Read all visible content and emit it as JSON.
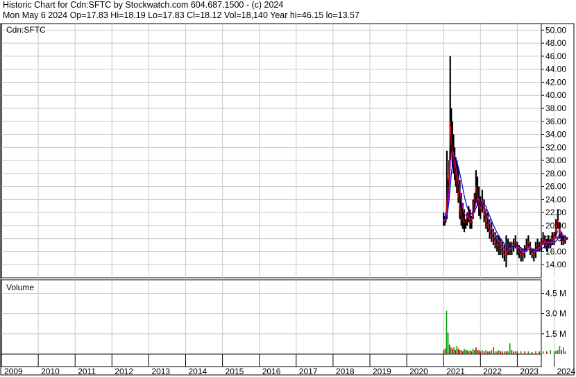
{
  "header": {
    "line1": "Historic Chart for Cdn:SFTC by Stockwatch.com 604.687.1500 - (c) 2024",
    "line2": "Mon May  6 2024   Op=17.83   Hi=18.19   Lo=17.83   Cl=18.12   Vol=18,140   Year hi=46.15   lo=13.57"
  },
  "chart_data": {
    "type": "line",
    "symbol_label": "Cdn:SFTC",
    "volume_label": "Volume",
    "price_axis": {
      "ylim": [
        12,
        51
      ],
      "ticks": [
        "14.00",
        "16.00",
        "18.00",
        "20.00",
        "22.00",
        "24.00",
        "26.00",
        "28.00",
        "30.00",
        "32.00",
        "34.00",
        "36.00",
        "38.00",
        "40.00",
        "42.00",
        "44.00",
        "46.00",
        "48.00",
        "50.00"
      ]
    },
    "volume_axis": {
      "ylim": [
        0,
        5.5
      ],
      "ticks": [
        "1.5 M",
        "3.0 M",
        "4.5 M"
      ]
    },
    "x_axis": {
      "years": [
        "2009",
        "2010",
        "2011",
        "2012",
        "2013",
        "2014",
        "2015",
        "2016",
        "2017",
        "2018",
        "2019",
        "2020",
        "2021",
        "2022",
        "2023",
        "2024"
      ]
    },
    "grid": true,
    "colors": {
      "price": "#000000",
      "ma_short": "#cc0000",
      "ma_long": "#0000cc",
      "ma_mid": "#cc00cc",
      "volume_up": "#00a000",
      "volume_down": "#cc0000",
      "grid": "#c8c8c8"
    },
    "price_series": {
      "x": [
        2021.0,
        2021.03,
        2021.06,
        2021.09,
        2021.12,
        2021.15,
        2021.18,
        2021.21,
        2021.24,
        2021.27,
        2021.3,
        2021.33,
        2021.36,
        2021.4,
        2021.44,
        2021.48,
        2021.52,
        2021.56,
        2021.6,
        2021.64,
        2021.68,
        2021.72,
        2021.76,
        2021.8,
        2021.84,
        2021.88,
        2021.92,
        2021.96,
        2022.0,
        2022.05,
        2022.1,
        2022.15,
        2022.2,
        2022.25,
        2022.3,
        2022.35,
        2022.4,
        2022.45,
        2022.5,
        2022.55,
        2022.6,
        2022.65,
        2022.7,
        2022.75,
        2022.8,
        2022.85,
        2022.9,
        2022.95,
        2023.0,
        2023.05,
        2023.1,
        2023.15,
        2023.2,
        2023.25,
        2023.3,
        2023.35,
        2023.4,
        2023.45,
        2023.5,
        2023.55,
        2023.6,
        2023.65,
        2023.7,
        2023.75,
        2023.8,
        2023.85,
        2023.9,
        2023.95,
        2024.0,
        2024.05,
        2024.1,
        2024.15,
        2024.2,
        2024.25,
        2024.3,
        2024.35
      ],
      "high": [
        22.0,
        21.5,
        22.0,
        31.5,
        27.0,
        30.0,
        46.0,
        38.0,
        36.0,
        34.0,
        32.0,
        30.5,
        30.0,
        29.0,
        27.0,
        25.0,
        23.5,
        22.5,
        21.0,
        22.0,
        23.0,
        22.5,
        21.5,
        24.0,
        25.0,
        28.5,
        27.5,
        26.0,
        24.5,
        25.5,
        24.0,
        22.5,
        22.0,
        21.0,
        20.5,
        19.5,
        19.0,
        18.5,
        18.5,
        18.0,
        17.5,
        17.0,
        18.5,
        18.0,
        17.5,
        17.5,
        18.0,
        18.5,
        17.5,
        17.0,
        16.5,
        16.5,
        17.0,
        18.0,
        18.5,
        17.5,
        16.5,
        16.5,
        17.5,
        18.0,
        17.5,
        18.0,
        19.0,
        18.5,
        18.0,
        18.5,
        18.0,
        19.0,
        19.0,
        21.0,
        22.5,
        20.5,
        19.0,
        18.5,
        18.5,
        18.2
      ],
      "low": [
        20.0,
        20.0,
        20.5,
        21.0,
        24.0,
        26.0,
        30.0,
        31.0,
        29.0,
        28.0,
        27.0,
        26.0,
        25.0,
        23.5,
        21.0,
        20.0,
        19.5,
        19.0,
        19.5,
        20.0,
        20.5,
        19.5,
        19.5,
        21.0,
        22.0,
        23.5,
        23.0,
        21.5,
        21.0,
        22.0,
        20.5,
        19.5,
        19.0,
        18.0,
        17.5,
        17.0,
        16.5,
        16.0,
        15.5,
        15.5,
        15.0,
        14.5,
        13.6,
        15.5,
        15.5,
        15.5,
        16.0,
        16.5,
        15.5,
        15.0,
        14.5,
        14.5,
        15.0,
        16.0,
        16.5,
        15.5,
        15.0,
        14.5,
        15.0,
        16.0,
        16.0,
        16.0,
        17.0,
        16.5,
        16.0,
        16.5,
        16.5,
        17.0,
        17.0,
        18.0,
        19.5,
        18.0,
        17.0,
        17.0,
        17.2,
        17.8
      ],
      "close": [
        21.0,
        20.5,
        21.5,
        24.0,
        26.5,
        28.0,
        36.0,
        33.0,
        31.0,
        30.0,
        28.5,
        28.0,
        26.5,
        25.0,
        23.0,
        21.5,
        21.0,
        20.5,
        20.5,
        21.5,
        22.0,
        20.5,
        20.5,
        23.0,
        24.0,
        26.0,
        24.5,
        23.0,
        22.5,
        24.0,
        22.0,
        20.5,
        20.0,
        19.0,
        18.5,
        18.0,
        17.5,
        17.0,
        17.0,
        16.5,
        16.0,
        15.5,
        15.5,
        17.0,
        16.5,
        16.5,
        17.0,
        17.5,
        16.5,
        16.0,
        15.5,
        15.5,
        16.0,
        17.0,
        17.5,
        16.5,
        15.5,
        15.5,
        16.5,
        17.0,
        16.5,
        17.0,
        18.0,
        17.5,
        17.0,
        17.5,
        17.0,
        18.0,
        18.0,
        19.5,
        21.0,
        19.0,
        18.0,
        17.5,
        18.0,
        18.12
      ],
      "ma_short": [
        21.0,
        20.8,
        21.0,
        22.0,
        23.5,
        25.5,
        29.0,
        31.0,
        31.5,
        31.0,
        30.0,
        29.0,
        28.0,
        26.8,
        25.5,
        24.0,
        22.8,
        22.0,
        21.5,
        21.3,
        21.3,
        21.0,
        21.0,
        21.6,
        22.4,
        23.5,
        24.2,
        24.0,
        23.5,
        23.4,
        23.0,
        22.2,
        21.2,
        20.3,
        19.6,
        19.0,
        18.5,
        18.0,
        17.6,
        17.2,
        16.8,
        16.3,
        16.0,
        16.2,
        16.4,
        16.6,
        16.8,
        17.0,
        16.9,
        16.6,
        16.2,
        15.9,
        15.8,
        16.2,
        16.7,
        16.8,
        16.4,
        16.0,
        16.0,
        16.4,
        16.6,
        16.8,
        17.2,
        17.4,
        17.4,
        17.4,
        17.4,
        17.5,
        17.7,
        18.3,
        19.2,
        19.3,
        19.0,
        18.5,
        18.2,
        18.1
      ],
      "ma_long": [
        21.0,
        21.0,
        21.0,
        21.5,
        22.5,
        24.0,
        26.0,
        28.0,
        29.3,
        30.0,
        30.3,
        30.2,
        29.8,
        29.0,
        28.0,
        27.0,
        25.8,
        24.6,
        23.6,
        22.8,
        22.3,
        22.0,
        21.8,
        21.9,
        22.2,
        22.7,
        23.3,
        23.6,
        23.6,
        23.5,
        23.3,
        22.9,
        22.2,
        21.5,
        20.8,
        20.1,
        19.5,
        18.9,
        18.4,
        18.0,
        17.6,
        17.2,
        16.9,
        16.8,
        16.7,
        16.7,
        16.8,
        16.9,
        16.9,
        16.8,
        16.6,
        16.4,
        16.2,
        16.2,
        16.3,
        16.4,
        16.3,
        16.2,
        16.1,
        16.2,
        16.3,
        16.4,
        16.6,
        16.8,
        16.9,
        17.0,
        17.1,
        17.2,
        17.3,
        17.6,
        18.0,
        18.3,
        18.4,
        18.3,
        18.2,
        18.1
      ]
    },
    "volume_series": {
      "x": [
        2021.0,
        2021.04,
        2021.08,
        2021.12,
        2021.16,
        2021.2,
        2021.24,
        2021.28,
        2021.32,
        2021.36,
        2021.4,
        2021.44,
        2021.48,
        2021.52,
        2021.56,
        2021.6,
        2021.64,
        2021.68,
        2021.72,
        2021.76,
        2021.8,
        2021.84,
        2021.88,
        2021.92,
        2021.96,
        2022.0,
        2022.05,
        2022.1,
        2022.15,
        2022.2,
        2022.25,
        2022.3,
        2022.35,
        2022.4,
        2022.45,
        2022.5,
        2022.55,
        2022.6,
        2022.65,
        2022.7,
        2022.75,
        2022.8,
        2022.85,
        2022.9,
        2022.95,
        2023.0,
        2023.1,
        2023.2,
        2023.3,
        2023.4,
        2023.5,
        2023.6,
        2023.7,
        2023.8,
        2023.9,
        2024.0,
        2024.05,
        2024.1,
        2024.15,
        2024.2,
        2024.25,
        2024.3
      ],
      "values": [
        0.3,
        0.4,
        3.2,
        1.6,
        0.7,
        0.5,
        0.4,
        0.5,
        0.3,
        0.6,
        0.4,
        0.3,
        0.3,
        0.2,
        0.4,
        0.3,
        0.3,
        0.2,
        0.3,
        0.2,
        0.4,
        0.3,
        0.5,
        0.3,
        0.3,
        0.2,
        0.3,
        0.2,
        0.3,
        0.2,
        0.2,
        0.3,
        0.5,
        0.2,
        0.2,
        0.3,
        0.2,
        0.2,
        0.2,
        0.2,
        0.2,
        0.8,
        0.3,
        0.2,
        0.2,
        0.2,
        0.2,
        0.2,
        0.2,
        0.15,
        0.2,
        0.2,
        0.2,
        0.2,
        0.3,
        0.2,
        0.25,
        0.3,
        0.6,
        0.3,
        0.5,
        0.2
      ],
      "up": [
        1,
        0,
        1,
        1,
        0,
        1,
        0,
        1,
        0,
        1,
        0,
        0,
        1,
        0,
        1,
        0,
        1,
        0,
        1,
        0,
        1,
        1,
        0,
        1,
        0,
        0,
        1,
        0,
        1,
        0,
        0,
        1,
        0,
        1,
        0,
        1,
        0,
        0,
        1,
        0,
        1,
        1,
        0,
        0,
        1,
        0,
        1,
        0,
        1,
        0,
        1,
        0,
        1,
        0,
        1,
        1,
        0,
        1,
        1,
        0,
        1,
        1
      ]
    }
  }
}
